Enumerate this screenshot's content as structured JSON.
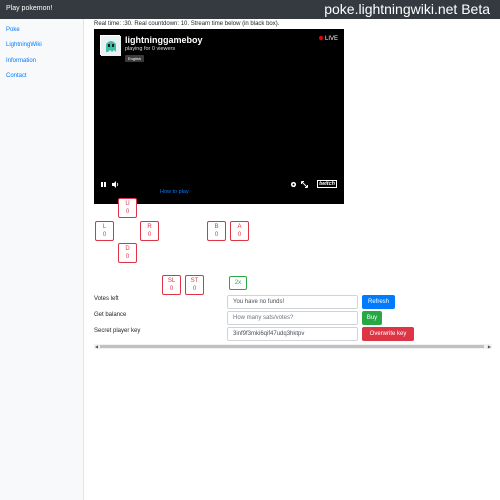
{
  "navbar": {
    "brand": "Play pokemon!",
    "site_title": "poke.lightningwiki.net Beta"
  },
  "sidebar": {
    "items": [
      {
        "label": "Poke"
      },
      {
        "label": "LightningWiki"
      },
      {
        "label": "Information"
      },
      {
        "label": "Contact"
      }
    ]
  },
  "status_line": "Real time: :30. Real countdown: 10. Stream time below (in black box).",
  "stream": {
    "channel": "lightninggameboy",
    "viewers": "playing for 0 viewers",
    "language": "English",
    "live_label": "LIVE",
    "live_color": "#eb0400",
    "icons": [
      "pause-icon",
      "volume-icon",
      "settings-icon",
      "fullscreen-icon"
    ],
    "platform_logo": "twitch"
  },
  "how_to_play": "How to play",
  "controls": {
    "up": {
      "label": "U",
      "count": "0"
    },
    "left": {
      "label": "L",
      "count": "0"
    },
    "right": {
      "label": "R",
      "count": "0"
    },
    "down": {
      "label": "D",
      "count": "0"
    },
    "b": {
      "label": "B",
      "count": "0"
    },
    "a": {
      "label": "A",
      "count": "0"
    },
    "select": {
      "label": "SL",
      "count": "0"
    },
    "start": {
      "label": "ST",
      "count": "0"
    },
    "multiplier": "2x",
    "button_color": "#dc3545",
    "multiplier_color": "#28a745"
  },
  "account": {
    "votes_left_label": "Votes left",
    "votes_left_value": "You have no funds!",
    "refresh_label": "Refresh",
    "balance_label": "Get balance",
    "balance_placeholder": "How many sats/votes?",
    "buy_label": "Buy",
    "key_label": "Secret player key",
    "key_value": "3inf9f3mki6qif47udq3hktpv",
    "overwrite_label": "Overwrite key",
    "colors": {
      "refresh": "#007bff",
      "buy": "#28a745",
      "overwrite": "#dc3545"
    }
  }
}
